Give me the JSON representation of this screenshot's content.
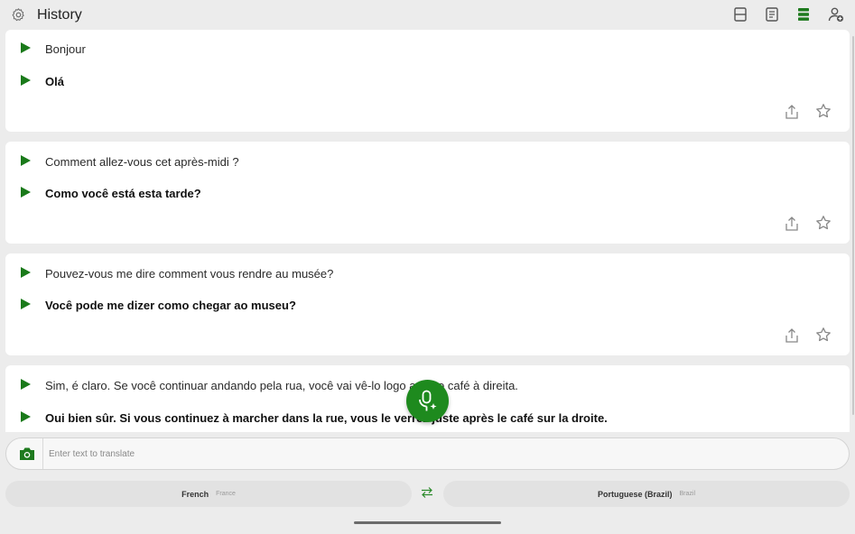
{
  "header": {
    "title": "History"
  },
  "entries": [
    {
      "source": "Bonjour",
      "translation": "Olá"
    },
    {
      "source": "Comment allez-vous cet après-midi ?",
      "translation": "Como você está esta tarde?"
    },
    {
      "source": "Pouvez-vous me dire comment vous rendre au musée?",
      "translation": "Você pode me dizer como chegar ao museu?"
    },
    {
      "source": "Sim, é claro. Se você continuar andando pela rua, você vai vê-lo logo após o café à direita.",
      "translation": "Oui bien sûr. Si vous continuez à marcher dans la rue, vous le verrez juste après le café sur la droite."
    }
  ],
  "input": {
    "placeholder": "Enter text to translate",
    "value": ""
  },
  "languages": {
    "source": {
      "name": "French",
      "region": "France"
    },
    "target": {
      "name": "Portuguese (Brazil)",
      "region": "Brazil"
    }
  },
  "colors": {
    "accent": "#1e8a1e",
    "play": "#1a7a1a",
    "background": "#ececec",
    "card": "#ffffff"
  },
  "icons": {
    "settings": "gear-icon",
    "layout_single": "single-pane-icon",
    "layout_doc": "document-icon",
    "layout_list": "list-view-icon",
    "add_user": "add-person-icon",
    "play": "play-icon",
    "share": "share-icon",
    "favorite": "star-icon",
    "camera": "camera-icon",
    "mic": "mic-sparkle-icon",
    "swap": "swap-icon"
  }
}
